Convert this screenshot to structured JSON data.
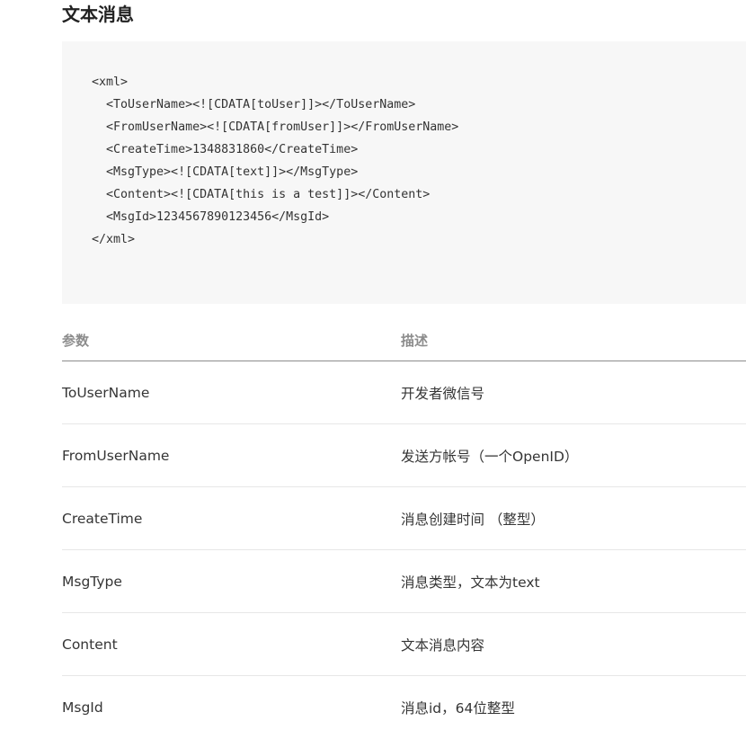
{
  "section": {
    "title": "文本消息"
  },
  "code": {
    "lines": [
      "<xml>",
      "  <ToUserName><![CDATA[toUser]]></ToUserName>",
      "  <FromUserName><![CDATA[fromUser]]></FromUserName>",
      "  <CreateTime>1348831860</CreateTime>",
      "  <MsgType><![CDATA[text]]></MsgType>",
      "  <Content><![CDATA[this is a test]]></Content>",
      "  <MsgId>1234567890123456</MsgId>",
      "</xml>"
    ]
  },
  "table": {
    "headers": {
      "param": "参数",
      "desc": "描述"
    },
    "rows": [
      {
        "param": "ToUserName",
        "desc": "开发者微信号"
      },
      {
        "param": "FromUserName",
        "desc": "发送方帐号（一个OpenID）"
      },
      {
        "param": "CreateTime",
        "desc": "消息创建时间 （整型）"
      },
      {
        "param": "MsgType",
        "desc": "消息类型，文本为text"
      },
      {
        "param": "Content",
        "desc": "文本消息内容"
      },
      {
        "param": "MsgId",
        "desc": "消息id，64位整型"
      }
    ]
  }
}
